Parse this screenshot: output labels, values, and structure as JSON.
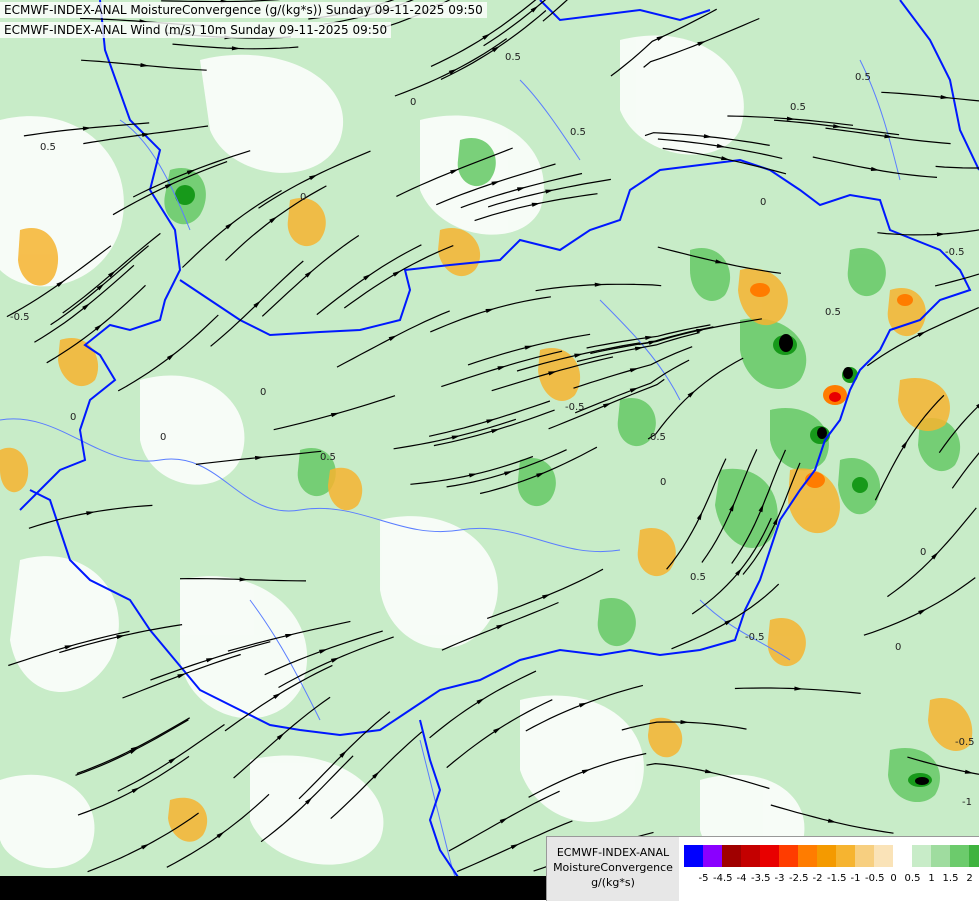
{
  "header": {
    "line1": "ECMWF-INDEX-ANAL MoistureConvergence (g/(kg*s)) Sunday 09-11-2025 09:50",
    "line2": "ECMWF-INDEX-ANAL Wind (m/s) 10m Sunday 09-11-2025 09:50"
  },
  "legend": {
    "line1": "ECMWF-INDEX-ANAL",
    "line2": "MoistureConvergence",
    "line3": "g/(kg*s)",
    "colors": [
      "#0000ff",
      "#8a00ff",
      "#a00000",
      "#c40000",
      "#e80000",
      "#ff3c00",
      "#ff7c00",
      "#f49a00",
      "#f6b430",
      "#f7cf80",
      "#fae3b8",
      "#ffffff",
      "#c8ecc8",
      "#9fdc9f",
      "#6ccb6c",
      "#3fb33f",
      "#17991a"
    ],
    "ticks": [
      "-5",
      "-4.5",
      "-4",
      "-3.5",
      "-3",
      "-2.5",
      "-2",
      "-1.5",
      "-1",
      "-0.5",
      "0",
      "0.5",
      "1",
      "1.5",
      "2"
    ]
  },
  "map": {
    "background": "#c8ecc8",
    "border_color": "#0018ff",
    "river_color": "#5a7dff",
    "streamline_color": "#000000",
    "contour_labels": [
      "0.5",
      "0",
      "-0.5",
      "0.5",
      "0",
      "0.5",
      "-0.5",
      "0",
      "0.5",
      "0",
      "0.5",
      "-0.5",
      "0",
      "0.5",
      "0",
      "-0.5",
      "0.5",
      "0",
      "0.5",
      "0",
      "0.5",
      "-0.5",
      "0",
      "-1"
    ]
  }
}
